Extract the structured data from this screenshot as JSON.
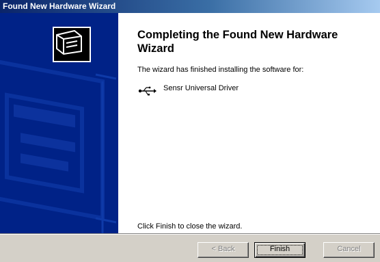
{
  "window": {
    "title": "Found New Hardware Wizard"
  },
  "content": {
    "heading": "Completing the Found New Hardware Wizard",
    "intro": "The wizard has finished installing the software for:",
    "device_name": "Sensr Universal Driver",
    "device_icon": "usb-icon",
    "closing": "Click Finish to close the wizard."
  },
  "buttons": {
    "back": "< Back",
    "finish": "Finish",
    "cancel": "Cancel"
  },
  "colors": {
    "side_panel": "#002287",
    "title_bar": "#0a246a",
    "dialog_face": "#d4d0c8"
  }
}
